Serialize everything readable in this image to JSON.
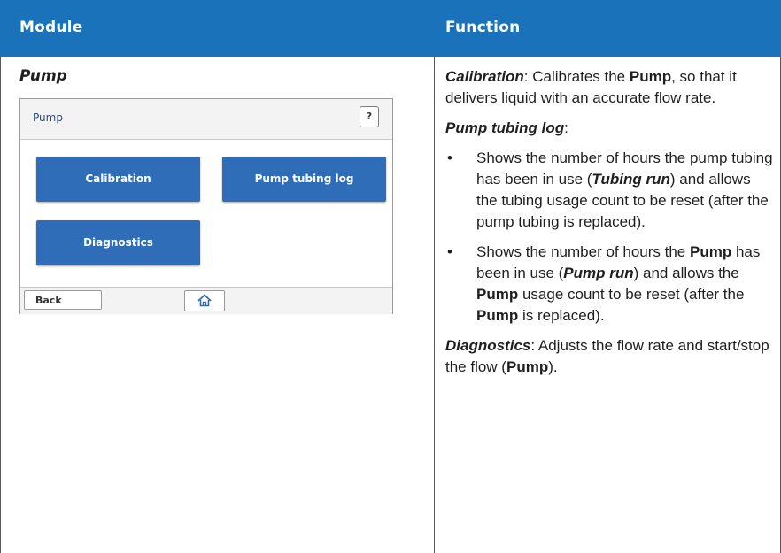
{
  "table": {
    "headers": [
      "Module",
      "Function"
    ],
    "header_color": "#1a72bb"
  },
  "module": {
    "name": "Pump"
  },
  "screen": {
    "title": "Pump",
    "help_label": "?",
    "tiles": [
      "Calibration",
      "Pump tubing log",
      "Diagnostics"
    ],
    "back_label": "Back",
    "home_icon": "home-icon",
    "tile_color": "#2f6db8"
  },
  "function": {
    "calibration": {
      "label": "Calibration",
      "t1": ": Calibrates the ",
      "pump": "Pump",
      "t2": ", so that it delivers liquid with an accurate flow rate."
    },
    "tubing_log": {
      "label": "Pump tubing log",
      "colon": ":"
    },
    "bullets": [
      {
        "marker": "•",
        "t1": "Shows the number of hours the pump tubing has been in use (",
        "em": "Tubing run",
        "t2": ") and allows the tubing usage count to be reset (after the pump tubing is replaced)."
      },
      {
        "marker": "•",
        "t1": "Shows the number of hours the ",
        "b1": "Pump",
        "t2": " has been in use (",
        "em": "Pump run",
        "t3": ") and allows the ",
        "b2": "Pump",
        "t4": " usage count to be reset (after the ",
        "b3": "Pump",
        "t5": " is replaced)."
      }
    ],
    "diagnostics": {
      "label": "Diagnostics",
      "t1": ": Adjusts the flow rate and start/stop the flow (",
      "pump": "Pump",
      "t2": ")."
    }
  }
}
